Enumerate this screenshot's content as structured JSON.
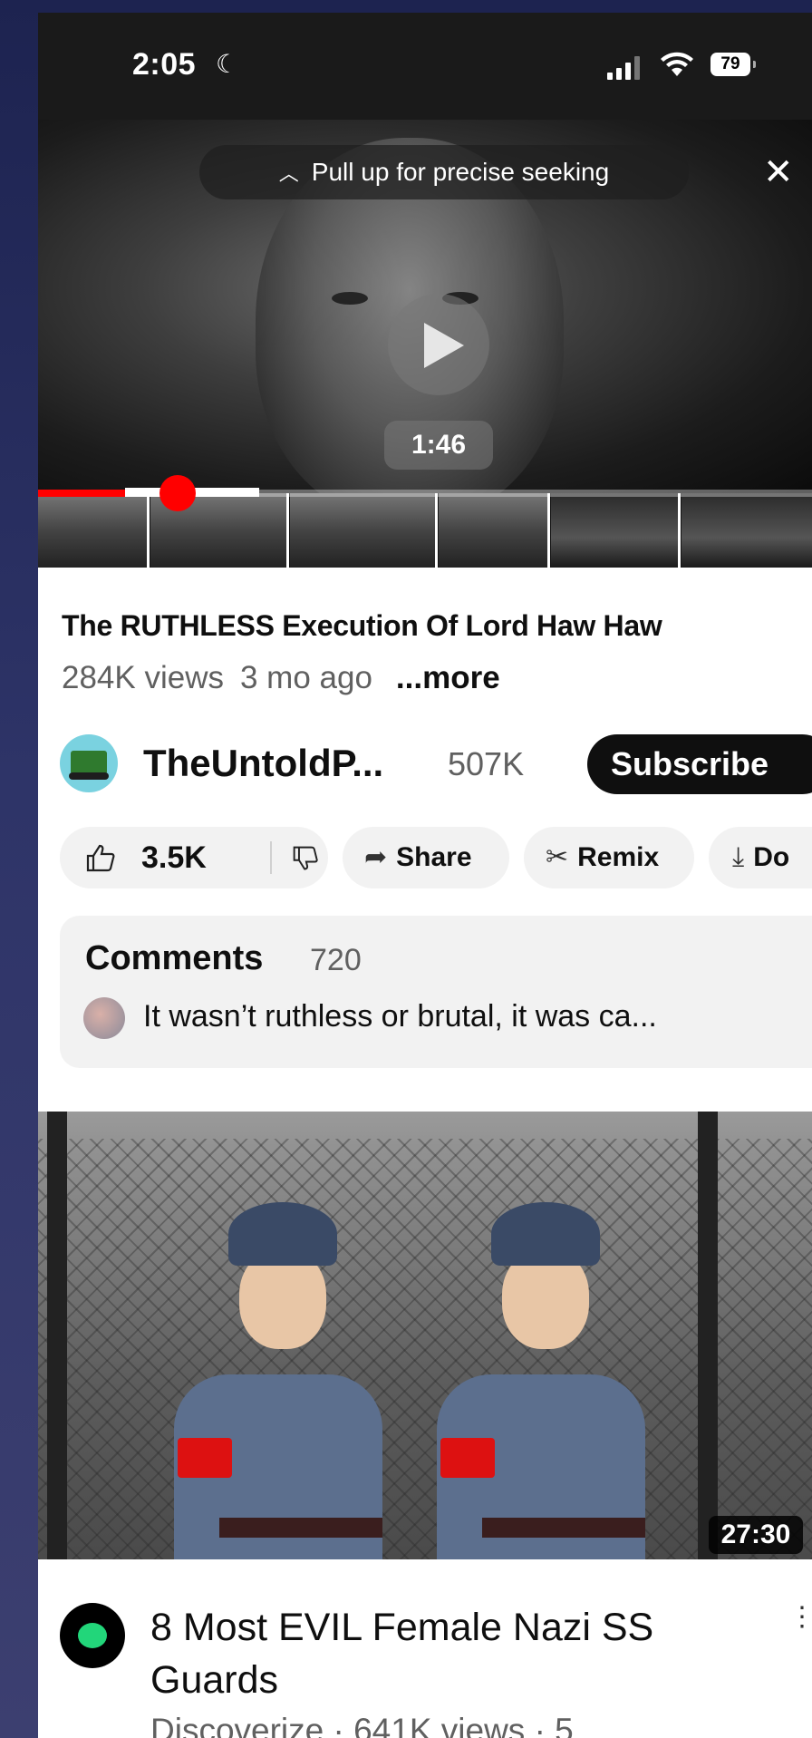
{
  "status_bar": {
    "time": "2:05",
    "battery": "79"
  },
  "player": {
    "seek_hint": "Pull up for precise seeking",
    "current_time": "1:46",
    "progress_fraction": 0.15
  },
  "video": {
    "title": "The RUTHLESS Execution Of Lord Haw Haw",
    "views": "284K views",
    "age": "3 mo ago",
    "more": "...more"
  },
  "channel": {
    "name": "TheUntoldP...",
    "subscribers": "507K",
    "subscribe_label": "Subscribe"
  },
  "actions": {
    "likes": "3.5K",
    "share_label": "Share",
    "remix_label": "Remix",
    "download_label": "Do"
  },
  "comments": {
    "title": "Comments",
    "count": "720",
    "top_comment": "It wasn’t ruthless or brutal, it was ca..."
  },
  "recommended": {
    "duration": "27:30",
    "title": "8 Most EVIL Female Nazi SS Guards",
    "meta": "Discoverize · 641K views · 5"
  },
  "colors": {
    "accent": "#ff0000",
    "button_dark": "#0f0f0f",
    "secondary_text": "#606060"
  }
}
